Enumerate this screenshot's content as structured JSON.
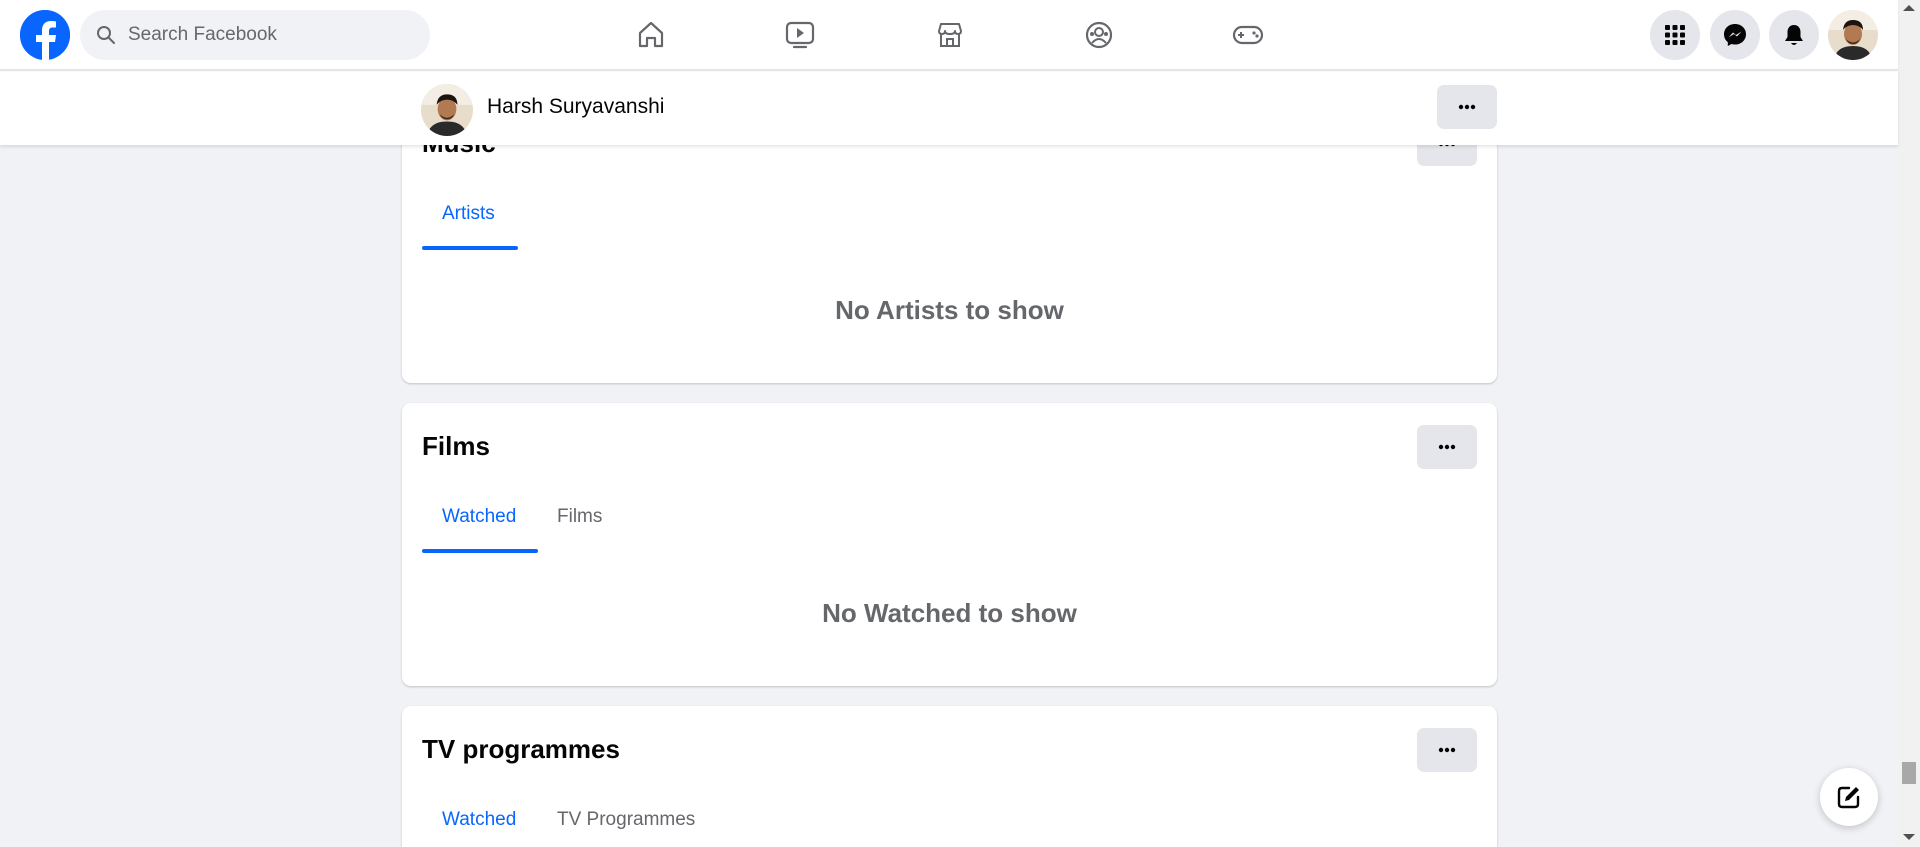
{
  "search": {
    "placeholder": "Search Facebook"
  },
  "nav": {
    "icons": [
      "home-icon",
      "video-icon",
      "marketplace-icon",
      "groups-icon",
      "gaming-icon"
    ]
  },
  "right_icons": [
    "menu-grid-icon",
    "messenger-icon",
    "notifications-icon",
    "account-avatar"
  ],
  "profile": {
    "name": "Harsh Suryavanshi"
  },
  "sections": {
    "music": {
      "title": "Music",
      "tabs": [
        "Artists"
      ],
      "empty": "No Artists to show"
    },
    "films": {
      "title": "Films",
      "tabs": [
        "Watched",
        "Films"
      ],
      "empty": "No Watched to show"
    },
    "tv": {
      "title": "TV programmes",
      "tabs": [
        "Watched",
        "TV Programmes"
      ]
    }
  },
  "colors": {
    "brand": "#0866ff",
    "background": "#f0f2f5",
    "muted_text": "#65676b"
  }
}
